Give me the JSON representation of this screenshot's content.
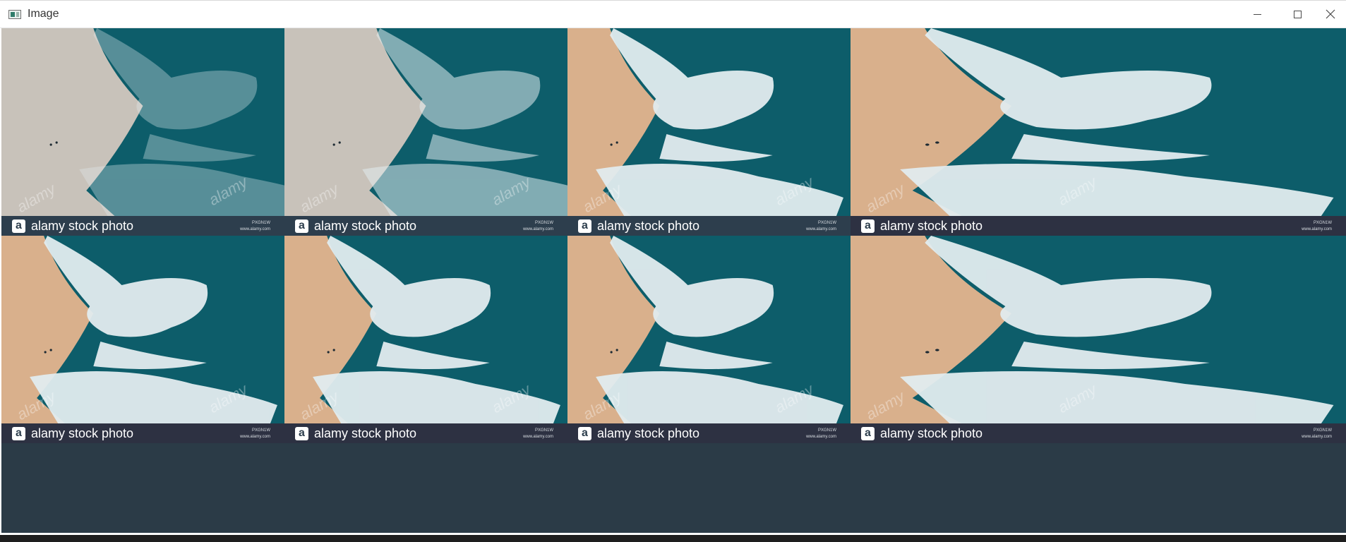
{
  "window": {
    "title": "Image",
    "controls": [
      "minimize-icon",
      "maximize-icon",
      "close-icon"
    ]
  },
  "watermark": {
    "brand_small": "alamy",
    "banner_text": "alamy stock photo",
    "logo_letter": "a",
    "image_id": "PXGN1W",
    "site": "www.alamy.com"
  },
  "colors": {
    "sea_dark": "#0d5d6a",
    "sand": "#d9b08c",
    "sand_grey": "#c8c2ba",
    "foam": "#e2ecef",
    "banner_blue": "#2d3e4d",
    "banner_dark": "#2d3142"
  },
  "tiles": [
    {
      "variant": "grey-sand-sparse",
      "banner": "blue"
    },
    {
      "variant": "grey-sand",
      "banner": "blue"
    },
    {
      "variant": "full-color",
      "banner": "blue"
    },
    {
      "variant": "full-color",
      "banner": "dark"
    },
    {
      "variant": "full-color",
      "banner": "dark"
    },
    {
      "variant": "full-color",
      "banner": "dark"
    },
    {
      "variant": "full-color",
      "banner": "dark"
    },
    {
      "variant": "full-color",
      "banner": "dark"
    }
  ]
}
